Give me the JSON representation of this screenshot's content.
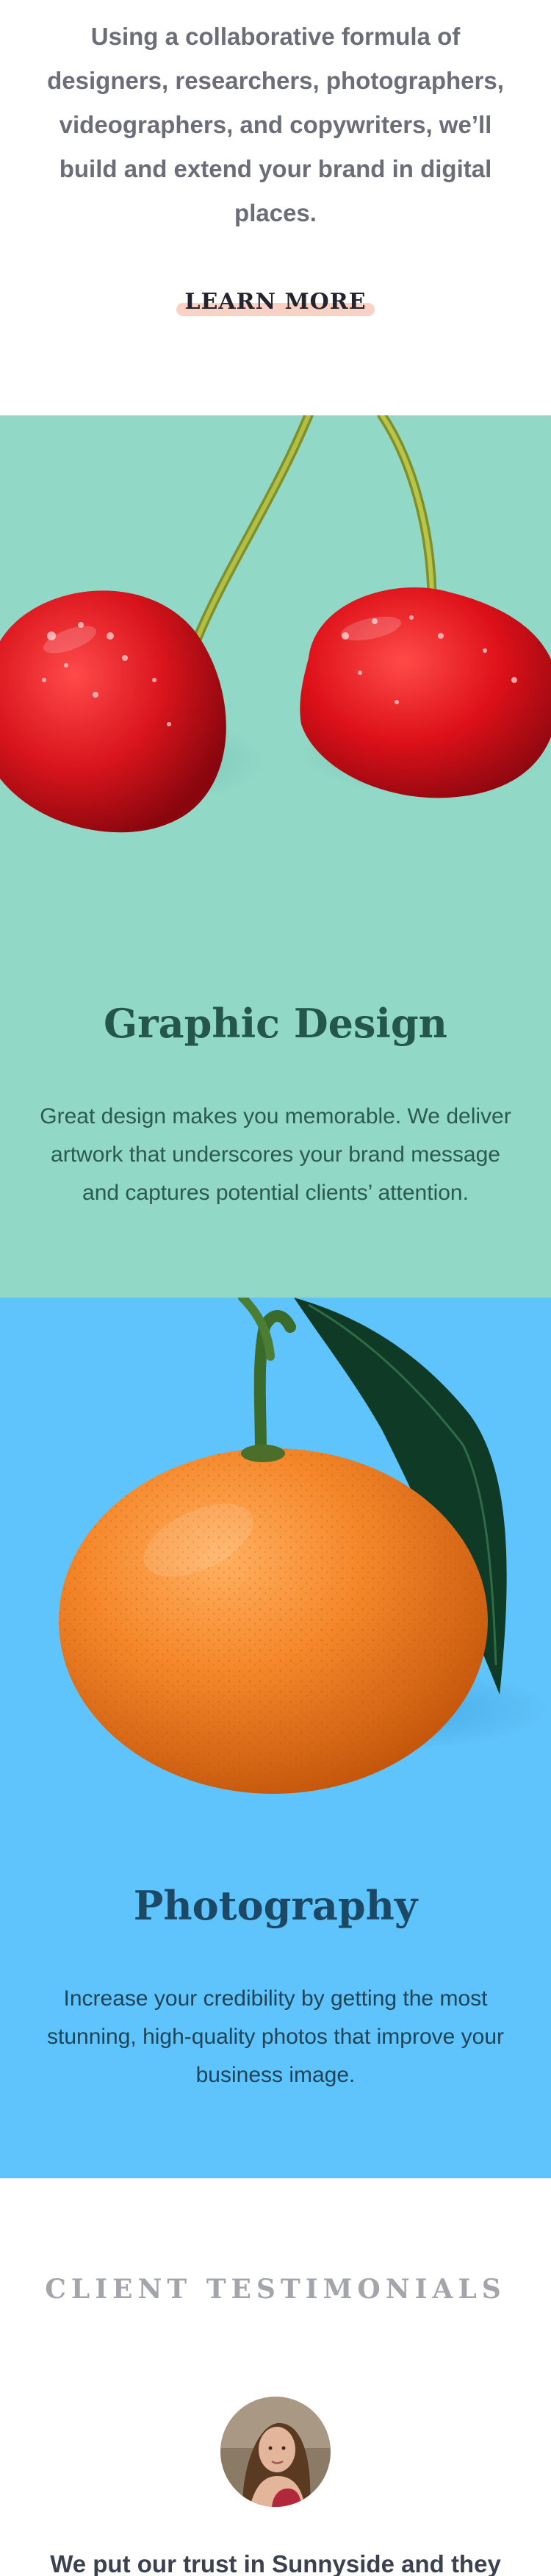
{
  "intro": {
    "text": "Using a collaborative formula of designers, researchers, photographers, videographers, and copywriters, we’ll build and extend your brand in digital places.",
    "learn_more_label": "LEARN MORE"
  },
  "services": {
    "graphic_design": {
      "title": "Graphic Design",
      "description": "Great design makes you memorable. We deliver artwork that underscores your brand message and captures potential clients’ attention.",
      "title_color": "#24574a",
      "text_color": "#2c5a50",
      "bg_color": "#91d8c7"
    },
    "photography": {
      "title": "Photography",
      "description": "Increase your credibility by getting the most stunning, high-quality photos that improve your business image.",
      "title_color": "#1b4864",
      "text_color": "#1f4459",
      "bg_color": "#5fc4fb"
    }
  },
  "testimonials": {
    "heading": "CLIENT TESTIMONIALS",
    "quote_start": "We put our trust in Sunnyside and they"
  },
  "icons": {
    "cherries": "cherries-illustration",
    "orange": "orange-illustration",
    "avatar": "client-avatar"
  }
}
